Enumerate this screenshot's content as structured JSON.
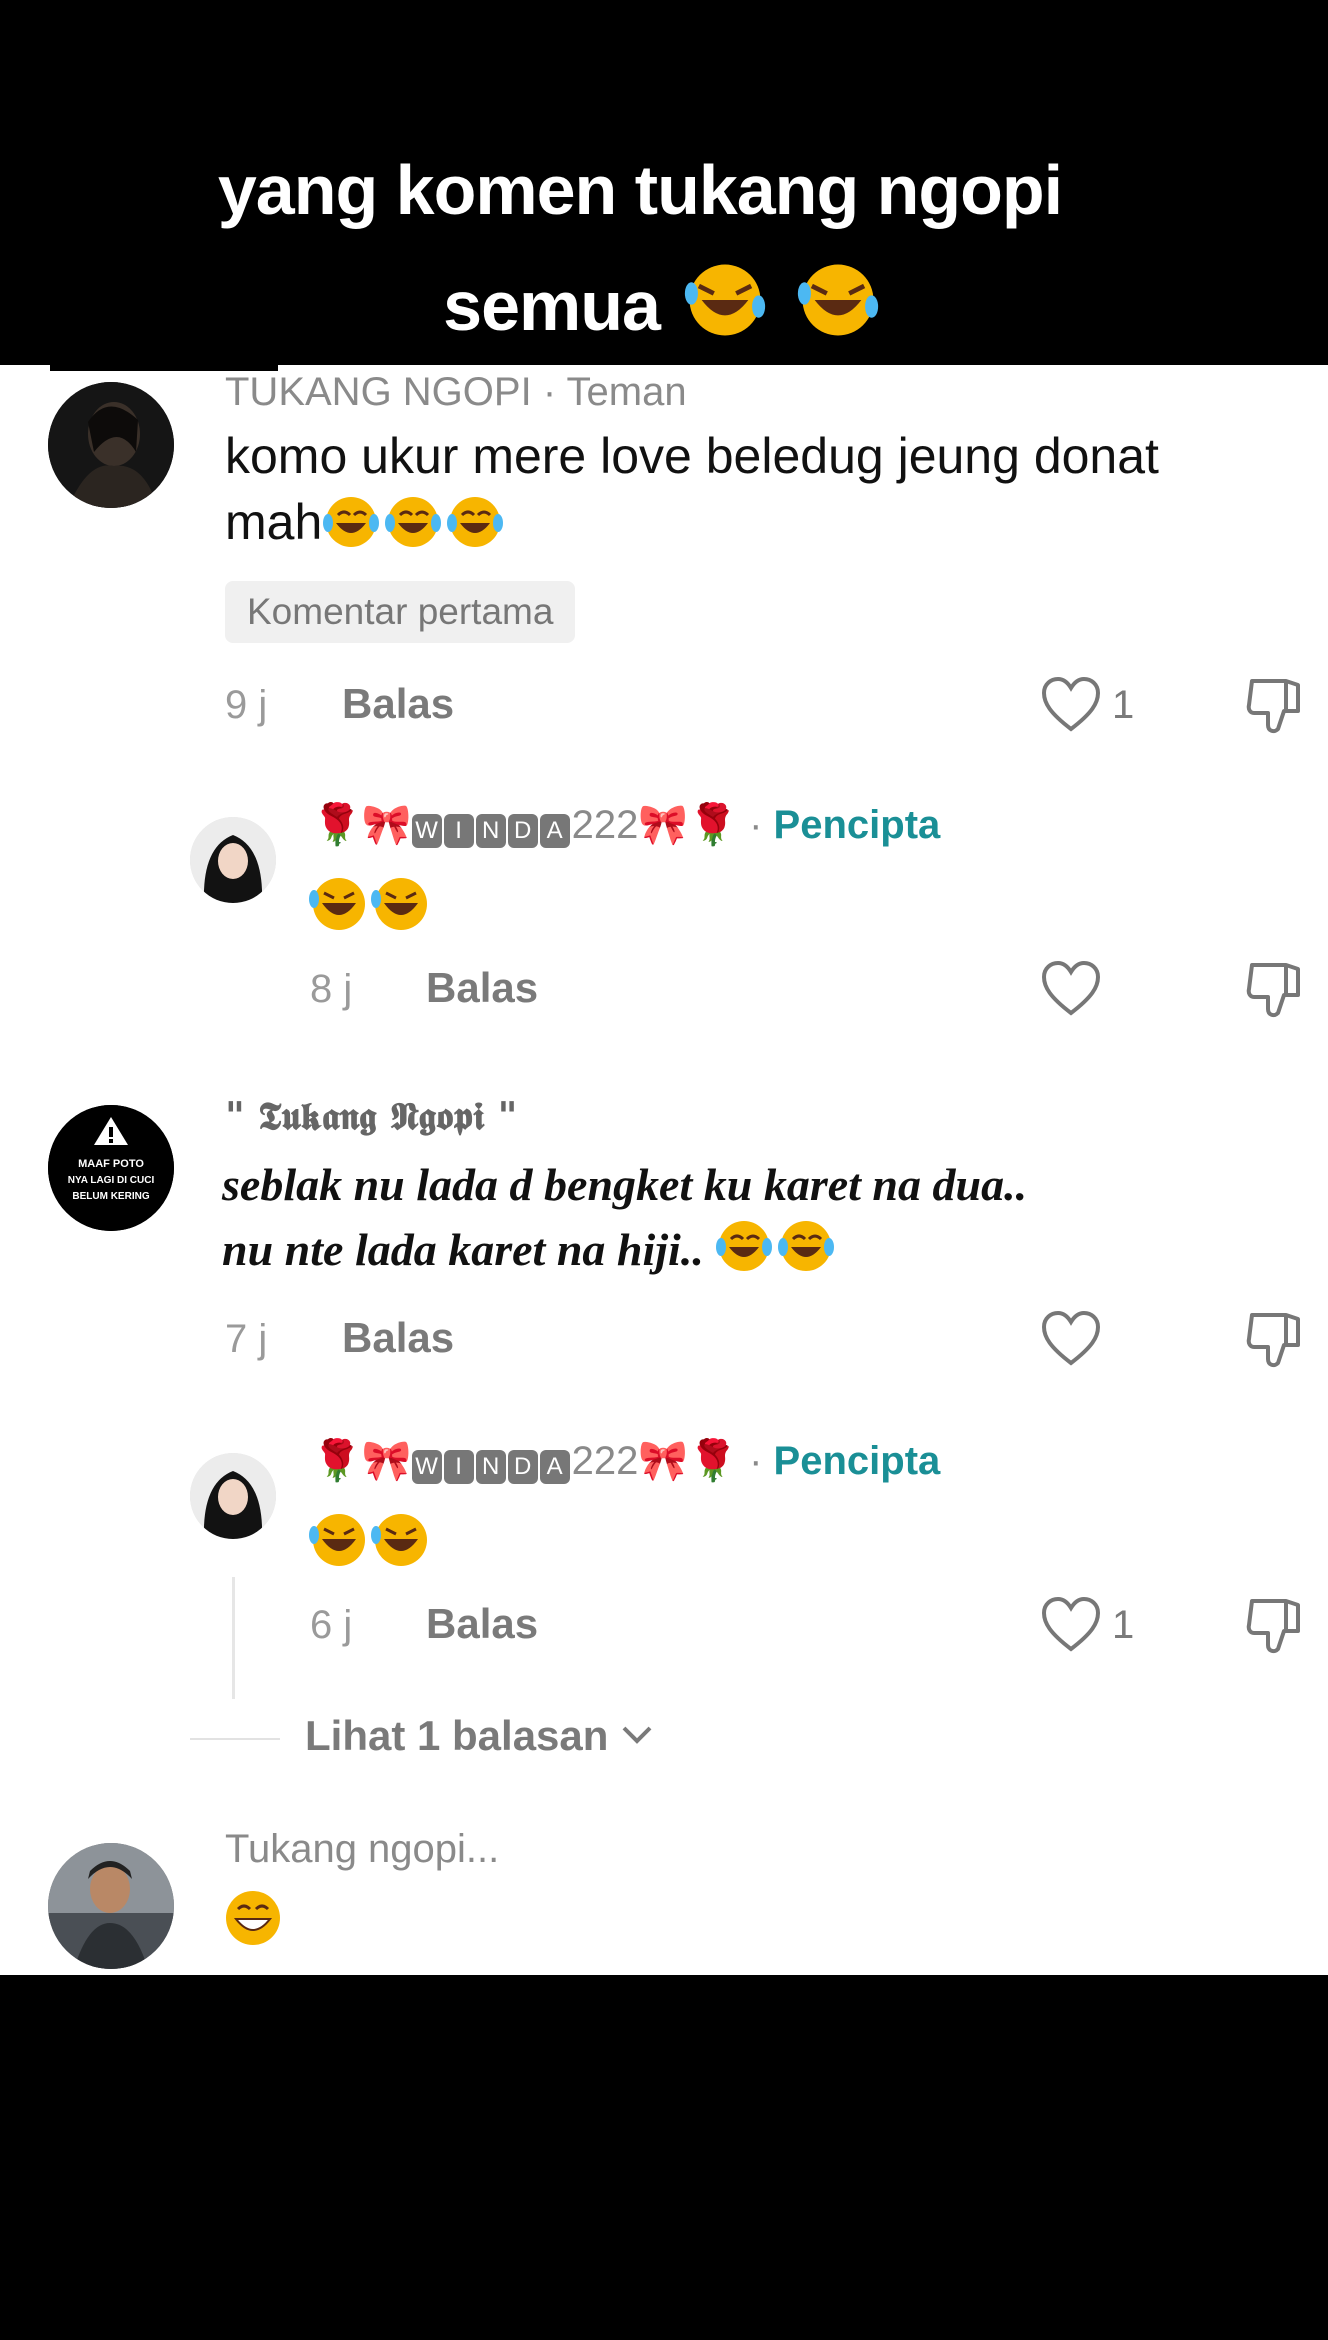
{
  "caption": {
    "line1": "yang komen tukang ngopi",
    "line2": "semua"
  },
  "comments": [
    {
      "user": "TUKANG NGOPI",
      "relation": "Teman",
      "text_line1": "komo ukur mere love beledug jeung donat",
      "text_line2": "mah",
      "badge": "Komentar pertama",
      "time": "9 j",
      "reply_label": "Balas",
      "likes": "1"
    },
    {
      "user_suffix": "222",
      "role": "Pencipta",
      "time": "8 j",
      "reply_label": "Balas"
    },
    {
      "user": "\" 𝕿𝖚𝖐𝖆𝖓𝖌 𝕹𝖌𝖔𝖕𝖎 \"",
      "text_line1": "seblak nu lada d bengket ku karet na dua..",
      "text_line2": "nu nte lada karet na hiji..",
      "time": "7 j",
      "reply_label": "Balas",
      "avatar_text": [
        "MAAF POTO",
        "NYA LAGI DI CUCI",
        "BELUM KERING"
      ]
    },
    {
      "user_suffix": "222",
      "role": "Pencipta",
      "time": "6 j",
      "reply_label": "Balas",
      "likes": "1"
    },
    {
      "user": "Tukang ngopi..."
    }
  ],
  "view_more": "Lihat 1 balasan",
  "winda_letters": [
    "W",
    "I",
    "N",
    "D",
    "A"
  ]
}
